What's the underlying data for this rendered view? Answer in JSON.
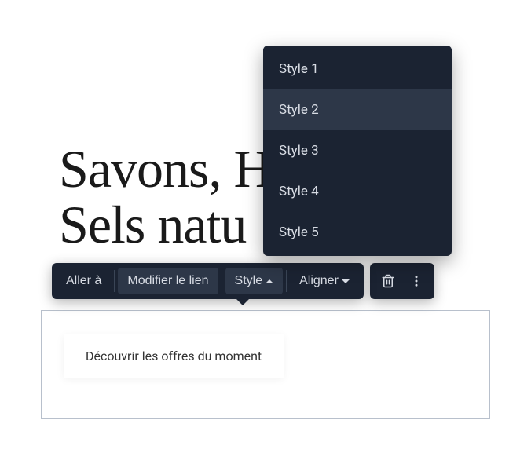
{
  "heading": {
    "line1": "Savons, H",
    "line2": "Sels natu"
  },
  "toolbar": {
    "goto_label": "Aller à",
    "edit_link_label": "Modifier le lien",
    "style_label": "Style",
    "align_label": "Aligner"
  },
  "dropdown": {
    "items": [
      {
        "label": "Style 1",
        "selected": false
      },
      {
        "label": "Style 2",
        "selected": true
      },
      {
        "label": "Style 3",
        "selected": false
      },
      {
        "label": "Style 4",
        "selected": false
      },
      {
        "label": "Style 5",
        "selected": false
      }
    ]
  },
  "cta": {
    "label": "Découvrir les offres du moment"
  }
}
